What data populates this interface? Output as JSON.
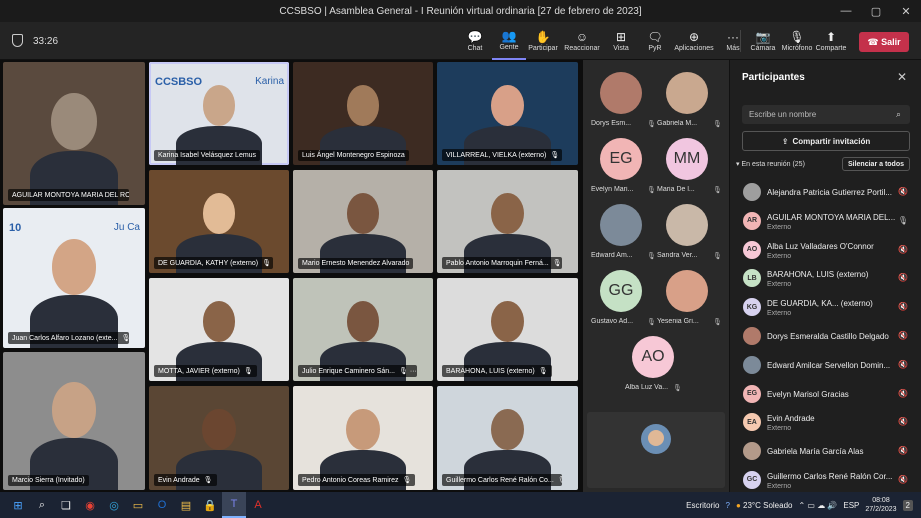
{
  "window": {
    "title": "CCSBSO | Asamblea General - I Reunión virtual ordinaria [27 de febrero de 2023]",
    "controls": [
      "—",
      "▢",
      "✕"
    ]
  },
  "toolbar": {
    "timer": "33:26",
    "tools": [
      {
        "label": "Chat",
        "icon": "💬"
      },
      {
        "label": "Gente",
        "icon": "👥"
      },
      {
        "label": "Participar",
        "icon": "✋"
      },
      {
        "label": "Reaccionar",
        "icon": "☺"
      },
      {
        "label": "Vista",
        "icon": "⊞"
      },
      {
        "label": "PyR",
        "icon": "🗨"
      },
      {
        "label": "Aplicaciones",
        "icon": "⊕"
      },
      {
        "label": "Más",
        "icon": "···"
      }
    ],
    "devices": [
      {
        "label": "Cámara",
        "icon": "📷"
      },
      {
        "label": "Micrófono",
        "icon": "🎙"
      },
      {
        "label": "Comparte",
        "icon": "⬆"
      }
    ],
    "leave_label": "Salir",
    "leave_icon": "☎"
  },
  "grid": [
    {
      "name": "AGUILAR MONTOYA MARIA DEL RO...",
      "mic": "🎙"
    },
    {
      "name": "Karina Isabel Velásquez Lemus",
      "mic": "",
      "badge": "CCSBSO",
      "brand": "Karina"
    },
    {
      "name": "Luis Ángel Montenegro Espinoza",
      "mic": ""
    },
    {
      "name": "VILLARREAL, VIELKA (externo)",
      "mic": "🎙"
    },
    {
      "name": "DE GUARDIA, KATHY (externo)",
      "mic": "🎙"
    },
    {
      "name": "Mario Ernesto Menendez Alvarado",
      "mic": ""
    },
    {
      "name": "Pablo Antonio Marroquin Ferná...",
      "mic": "🎙"
    },
    {
      "name": "Juan Carlos Alfaro Lozano (exte...",
      "mic": "🎙",
      "badge": "10",
      "brand": "Ju Ca"
    },
    {
      "name": "MOTTA, JAVIER (externo)",
      "mic": "🎙"
    },
    {
      "name": "Julio Enrique Caminero Sán...",
      "mic": "🎙 ···"
    },
    {
      "name": "BARAHONA, LUIS (externo)",
      "mic": "🎙"
    },
    {
      "name": "Marcio Sierra (Invitado)",
      "mic": ""
    },
    {
      "name": "Evin Andrade",
      "mic": "🎙"
    },
    {
      "name": "Pedro Antonio Coreas Ramirez",
      "mic": "🎙"
    },
    {
      "name": "Guillermo Carlos René Ralón Co...",
      "mic": "🎙"
    }
  ],
  "side_tiles": [
    {
      "name": "Dorys Esm...",
      "initials": ""
    },
    {
      "name": "Gabriela M...",
      "initials": ""
    },
    {
      "name": "Evelyn Mari...",
      "initials": "EG"
    },
    {
      "name": "Maria De l...",
      "initials": "MM"
    },
    {
      "name": "Edward Am...",
      "initials": ""
    },
    {
      "name": "Sandra Ver...",
      "initials": ""
    },
    {
      "name": "Gustavo Ad...",
      "initials": "GG"
    },
    {
      "name": "Yesenia Gri...",
      "initials": ""
    },
    {
      "name": "Alba Luz Va...",
      "initials": "AO"
    }
  ],
  "panel": {
    "title": "Participantes",
    "search_placeholder": "Escribe un nombre",
    "invite_label": "Compartir invitación",
    "in_meeting_label": "En esta reunión (25)",
    "mute_all_label": "Silenciar a todos",
    "participants": [
      {
        "name": "Alejandra Patricia Gutierrez Portil...",
        "sub": "",
        "initials": "",
        "color": "#9e9e9e",
        "mic": "🔇"
      },
      {
        "name": "AGUILAR MONTOYA MARIA DEL...",
        "sub": "Externo",
        "initials": "AR",
        "color": "#f1b5b5",
        "mic": "🎙"
      },
      {
        "name": "Alba Luz Valladares O'Connor",
        "sub": "Externo",
        "initials": "AO",
        "color": "#f7c8d6",
        "mic": "🔇"
      },
      {
        "name": "BARAHONA, LUIS (externo)",
        "sub": "Externo",
        "initials": "LB",
        "color": "#c5e1c5",
        "mic": "🔇"
      },
      {
        "name": "DE GUARDIA, KA... (externo)",
        "sub": "Externo",
        "initials": "KG",
        "color": "#d7d2ef",
        "mic": "🔇"
      },
      {
        "name": "Dorys Esmeralda Castillo Delgado",
        "sub": "",
        "initials": "",
        "color": "#b07a6a",
        "mic": "🔇"
      },
      {
        "name": "Edward Amilcar Servellon Domin...",
        "sub": "",
        "initials": "",
        "color": "#7c8a99",
        "mic": "🔇"
      },
      {
        "name": "Evelyn Marisol Gracias",
        "sub": "",
        "initials": "EG",
        "color": "#f1b5b5",
        "mic": "🔇"
      },
      {
        "name": "Evin Andrade",
        "sub": "Externo",
        "initials": "EA",
        "color": "#f5c9b0",
        "mic": "🔇"
      },
      {
        "name": "Gabriela María García Alas",
        "sub": "",
        "initials": "",
        "color": "#b39a8a",
        "mic": "🔇"
      },
      {
        "name": "Guillermo Carlos René Ralón Cor...",
        "sub": "Externo",
        "initials": "GC",
        "color": "#d7d2ef",
        "mic": "🔇"
      }
    ]
  },
  "taskbar": {
    "icons": [
      "⊞",
      "⌕",
      "❏",
      "◉",
      "◎",
      "▭",
      "O",
      "▤",
      "🔒",
      "T",
      "A"
    ],
    "desktop_label": "Escritorio",
    "weather": "23°C  Soleado",
    "tray": "⌃ ▭ ☁ 🔊",
    "lang": "ESP",
    "time": "08:08",
    "date": "27/2/2023",
    "notif": "2"
  }
}
